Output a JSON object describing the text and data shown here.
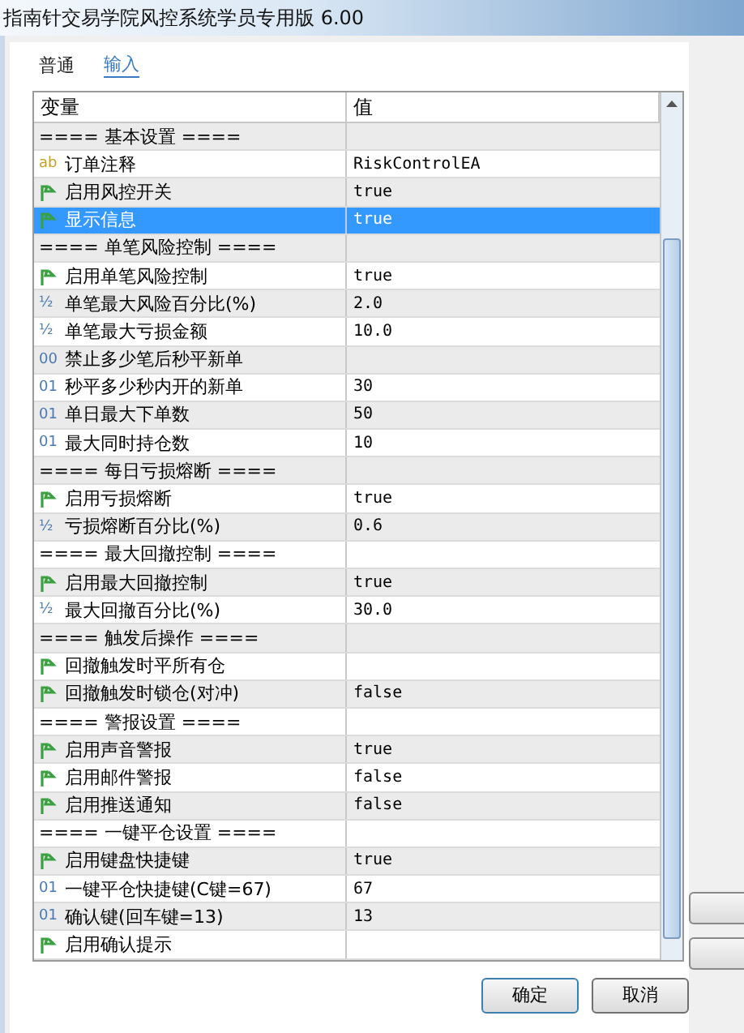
{
  "window": {
    "title": "指南针交易学院风控系统学员专用版 6.00"
  },
  "tabs": [
    {
      "label": "普通",
      "selected": false
    },
    {
      "label": "输入",
      "selected": true
    }
  ],
  "table": {
    "columns": [
      "变量",
      "值"
    ],
    "rows": [
      {
        "kind": "section",
        "name": "==== 基本设置 ====",
        "value": "",
        "selected": false
      },
      {
        "kind": "string",
        "icon": "ab",
        "name": "订单注释",
        "value": "RiskControlEA",
        "selected": false
      },
      {
        "kind": "bool",
        "name": "启用风控开关",
        "value": "true",
        "selected": false
      },
      {
        "kind": "bool",
        "name": "显示信息",
        "value": "true",
        "selected": true
      },
      {
        "kind": "section",
        "name": "==== 单笔风险控制 ====",
        "value": "",
        "selected": false
      },
      {
        "kind": "bool",
        "name": "启用单笔风险控制",
        "value": "true",
        "selected": false
      },
      {
        "kind": "double",
        "icon": "½",
        "name": "单笔最大风险百分比(%)",
        "value": "2.0",
        "selected": false
      },
      {
        "kind": "double",
        "icon": "½",
        "name": "单笔最大亏损金额",
        "value": "10.0",
        "selected": false
      },
      {
        "kind": "int",
        "icon": "00",
        "name": "禁止多少笔后秒平新单",
        "value": "",
        "selected": false
      },
      {
        "kind": "int",
        "icon": "01",
        "name": "秒平多少秒内开的新单",
        "value": "30",
        "selected": false
      },
      {
        "kind": "int",
        "icon": "01",
        "name": "单日最大下单数",
        "value": "50",
        "selected": false
      },
      {
        "kind": "int",
        "icon": "01",
        "name": "最大同时持仓数",
        "value": "10",
        "selected": false
      },
      {
        "kind": "section",
        "name": "==== 每日亏损熔断 ====",
        "value": "",
        "selected": false
      },
      {
        "kind": "bool",
        "name": "启用亏损熔断",
        "value": "true",
        "selected": false
      },
      {
        "kind": "double",
        "icon": "½",
        "name": "亏损熔断百分比(%)",
        "value": "0.6",
        "selected": false
      },
      {
        "kind": "section",
        "name": "==== 最大回撤控制 ====",
        "value": "",
        "selected": false
      },
      {
        "kind": "bool",
        "name": "启用最大回撤控制",
        "value": "true",
        "selected": false
      },
      {
        "kind": "double",
        "icon": "½",
        "name": "最大回撤百分比(%)",
        "value": "30.0",
        "selected": false
      },
      {
        "kind": "section",
        "name": "==== 触发后操作 ====",
        "value": "",
        "selected": false
      },
      {
        "kind": "bool",
        "name": "回撤触发时平所有仓",
        "value": "",
        "selected": false
      },
      {
        "kind": "bool",
        "name": "回撤触发时锁仓(对冲)",
        "value": "false",
        "selected": false
      },
      {
        "kind": "section",
        "name": "==== 警报设置 ====",
        "value": "",
        "selected": false
      },
      {
        "kind": "bool",
        "name": "启用声音警报",
        "value": "true",
        "selected": false
      },
      {
        "kind": "bool",
        "name": "启用邮件警报",
        "value": "false",
        "selected": false
      },
      {
        "kind": "bool",
        "name": "启用推送通知",
        "value": "false",
        "selected": false
      },
      {
        "kind": "section",
        "name": "==== 一键平仓设置 ====",
        "value": "",
        "selected": false
      },
      {
        "kind": "bool",
        "name": "启用键盘快捷键",
        "value": "true",
        "selected": false
      },
      {
        "kind": "int",
        "icon": "01",
        "name": "一键平仓快捷键(C键=67)",
        "value": "67",
        "selected": false
      },
      {
        "kind": "int",
        "icon": "01",
        "name": "确认键(回车键=13)",
        "value": "13",
        "selected": false
      },
      {
        "kind": "bool",
        "name": "启用确认提示",
        "value": "",
        "selected": false
      }
    ]
  },
  "buttons": [
    "确定",
    "取消"
  ]
}
